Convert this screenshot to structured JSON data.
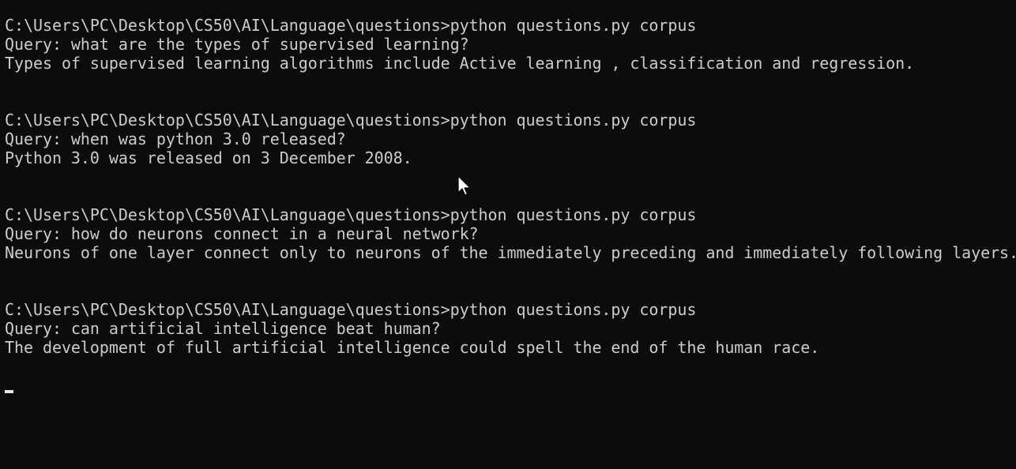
{
  "terminal": {
    "sessions": [
      {
        "prompt": "C:\\Users\\PC\\Desktop\\CS50\\AI\\Language\\questions>python questions.py corpus",
        "query": "Query: what are the types of supervised learning?",
        "answer": "Types of supervised learning algorithms include Active learning , classification and regression."
      },
      {
        "prompt": "C:\\Users\\PC\\Desktop\\CS50\\AI\\Language\\questions>python questions.py corpus",
        "query": "Query: when was python 3.0 released?",
        "answer": "Python 3.0 was released on 3 December 2008."
      },
      {
        "prompt": "C:\\Users\\PC\\Desktop\\CS50\\AI\\Language\\questions>python questions.py corpus",
        "query": "Query: how do neurons connect in a neural network?",
        "answer": "Neurons of one layer connect only to neurons of the immediately preceding and immediately following layers."
      },
      {
        "prompt": "C:\\Users\\PC\\Desktop\\CS50\\AI\\Language\\questions>python questions.py corpus",
        "query": "Query: can artificial intelligence beat human?",
        "answer": "The development of full artificial intelligence could spell the end of the human race."
      }
    ]
  },
  "colors": {
    "background": "#0c0c0c",
    "text": "#cccccc",
    "cursor": "#e8e8e8"
  },
  "icons": {
    "pointer": "mouse-pointer-icon"
  }
}
